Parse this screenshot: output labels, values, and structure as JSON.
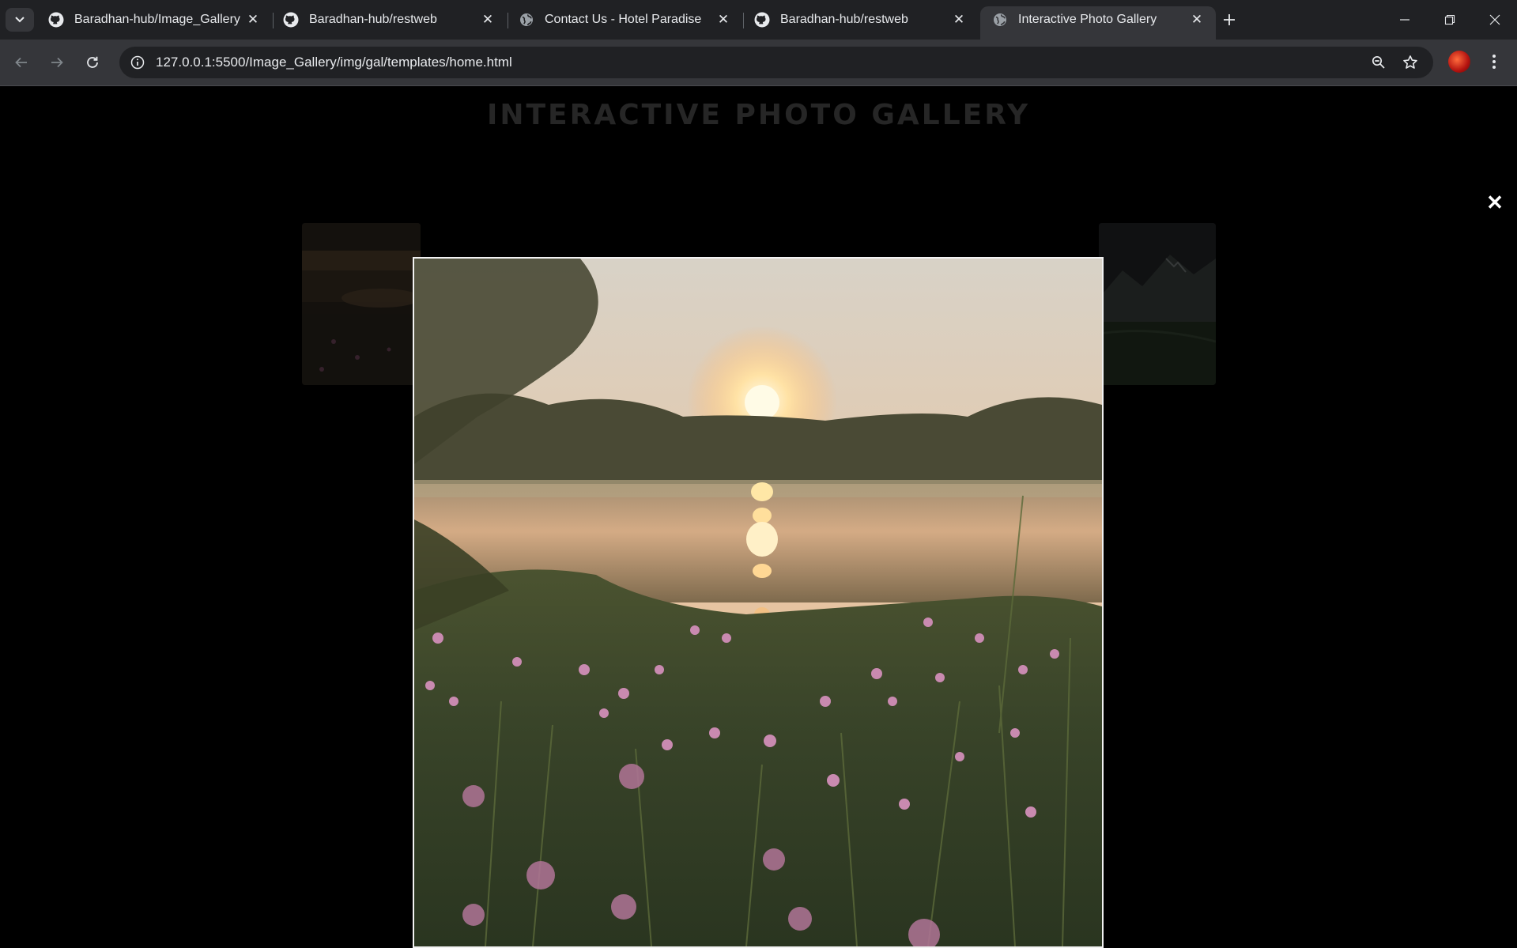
{
  "browser": {
    "tabs": [
      {
        "title": "Baradhan-hub/Image_Gallery",
        "icon": "github-icon",
        "active": false
      },
      {
        "title": "Baradhan-hub/restweb",
        "icon": "github-icon",
        "active": false
      },
      {
        "title": "Contact Us - Hotel Paradise",
        "icon": "globe-icon",
        "active": false
      },
      {
        "title": "Baradhan-hub/restweb",
        "icon": "github-icon",
        "active": false
      },
      {
        "title": "Interactive Photo Gallery",
        "icon": "globe-icon",
        "active": true
      }
    ],
    "url": "127.0.0.1:5500/Image_Gallery/img/gal/templates/home.html"
  },
  "page": {
    "title": "INTERACTIVE PHOTO GALLERY",
    "close_symbol": "✕"
  },
  "colors": {
    "tabstrip_bg": "#202124",
    "toolbar_bg": "#35363a",
    "page_bg": "#000000",
    "modal_border": "#f2f2f2"
  }
}
